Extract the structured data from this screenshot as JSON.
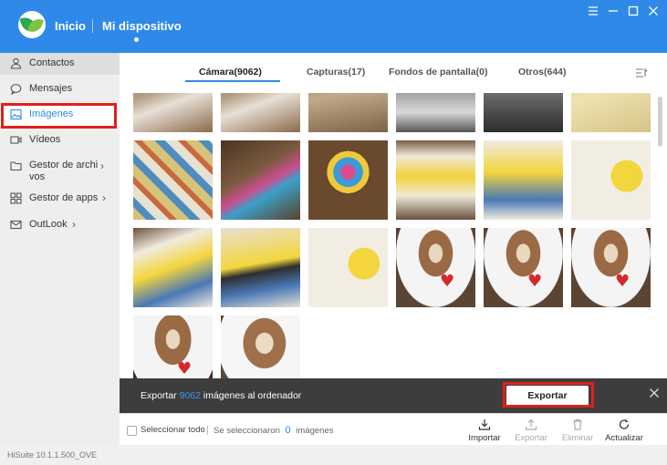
{
  "header": {
    "nav_home": "Inicio",
    "nav_device": "Mi dispositivo",
    "brand_color": "#2f89e8"
  },
  "window": {
    "minimize_icon": "menu-icon",
    "buttons": [
      "menu",
      "minimize",
      "maximize",
      "close"
    ]
  },
  "sidebar": {
    "items": [
      {
        "label": "Contactos",
        "icon": "person-icon"
      },
      {
        "label": "Mensajes",
        "icon": "chat-bubble-icon"
      },
      {
        "label": "Imágenes",
        "icon": "image-icon"
      },
      {
        "label": "Vídeos",
        "icon": "video-icon"
      },
      {
        "label": "Gestor de archi",
        "label2": "vos",
        "icon": "folder-icon"
      },
      {
        "label": "Gestor de apps",
        "icon": "apps-grid-icon"
      },
      {
        "label": "OutLook",
        "icon": "mail-icon"
      }
    ],
    "active_index": 2
  },
  "tabs": [
    {
      "label": "Cámara(9062)"
    },
    {
      "label": "Capturas(17)"
    },
    {
      "label": "Fondos de pantalla(0)"
    },
    {
      "label": "Otros(644)"
    }
  ],
  "active_tab": 0,
  "thumbnails": [
    "hands-with-card",
    "hands-with-card",
    "photo-stack",
    "sign-169",
    "street-scene",
    "yellow-cards",
    "photo-collage",
    "markers-on-table",
    "markers-in-cup",
    "homer-drawing-held",
    "homer-drawing",
    "homer-bubble-drawing",
    "homer-pointing-drawing",
    "homer-drawing-pen",
    "homer-bubble-drawing",
    "latte-heart-mug",
    "latte-heart-mug",
    "latte-heart-mug",
    "latte-mug-note",
    "latte-heart-cup"
  ],
  "export_bar": {
    "prefix": "Exportar",
    "count": "9062",
    "suffix": "imágenes al ordenador",
    "button": "Exportar"
  },
  "footer": {
    "select_all": "Seleccionar todo",
    "selected_prefix": "Se seleccionaron",
    "selected_count": "0",
    "selected_suffix": "imágenes",
    "actions": [
      {
        "label": "Importar",
        "icon": "import-icon",
        "enabled": true
      },
      {
        "label": "Exportar",
        "icon": "export-icon",
        "enabled": false
      },
      {
        "label": "Eliminar",
        "icon": "trash-icon",
        "enabled": false
      },
      {
        "label": "Actualizar",
        "icon": "refresh-icon",
        "enabled": true
      }
    ]
  },
  "version": "HiSuite 10.1.1.500_OVE",
  "highlight_color": "#e0201a"
}
